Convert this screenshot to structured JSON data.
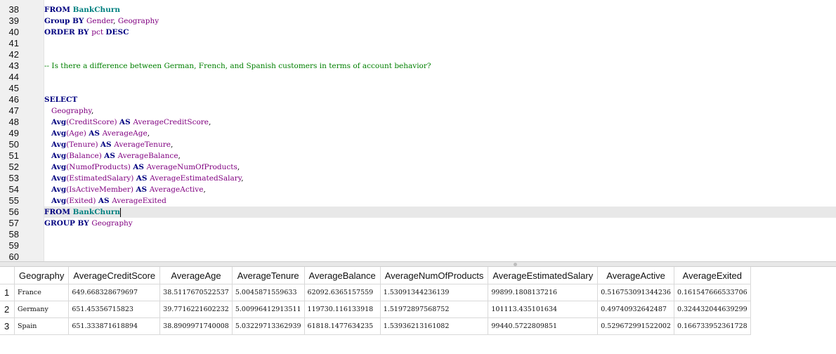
{
  "editor": {
    "line_numbers": [
      "38",
      "39",
      "40",
      "41",
      "42",
      "43",
      "44",
      "45",
      "46",
      "47",
      "48",
      "49",
      "50",
      "51",
      "52",
      "53",
      "54",
      "55",
      "56",
      "57",
      "58",
      "59",
      "60"
    ],
    "current_line": "56",
    "lines": [
      [
        {
          "t": "FROM ",
          "c": "kw"
        },
        {
          "t": "BankChurn",
          "c": "tb"
        }
      ],
      [
        {
          "t": "Group BY ",
          "c": "kw"
        },
        {
          "t": "Gender",
          "c": "id"
        },
        {
          "t": ", ",
          "c": "pl"
        },
        {
          "t": "Geography",
          "c": "id"
        }
      ],
      [
        {
          "t": "ORDER BY ",
          "c": "kw"
        },
        {
          "t": "pct ",
          "c": "id"
        },
        {
          "t": "DESC",
          "c": "kw"
        }
      ],
      [],
      [],
      [
        {
          "t": "-- Is there a difference between German, French, and Spanish customers in terms of account behavior?",
          "c": "cm"
        }
      ],
      [],
      [],
      [
        {
          "t": "SELECT",
          "c": "kw"
        }
      ],
      [
        {
          "t": "   ",
          "c": "pl"
        },
        {
          "t": "Geography",
          "c": "id"
        },
        {
          "t": ",",
          "c": "pl"
        }
      ],
      [
        {
          "t": "   ",
          "c": "pl"
        },
        {
          "t": "Avg",
          "c": "kw"
        },
        {
          "t": "(CreditScore) ",
          "c": "id"
        },
        {
          "t": "AS ",
          "c": "kw"
        },
        {
          "t": "AverageCreditScore",
          "c": "id"
        },
        {
          "t": ",",
          "c": "pl"
        }
      ],
      [
        {
          "t": "   ",
          "c": "pl"
        },
        {
          "t": "Avg",
          "c": "kw"
        },
        {
          "t": "(Age) ",
          "c": "id"
        },
        {
          "t": "AS ",
          "c": "kw"
        },
        {
          "t": "AverageAge",
          "c": "id"
        },
        {
          "t": ",",
          "c": "pl"
        }
      ],
      [
        {
          "t": "   ",
          "c": "pl"
        },
        {
          "t": "Avg",
          "c": "kw"
        },
        {
          "t": "(Tenure) ",
          "c": "id"
        },
        {
          "t": "AS ",
          "c": "kw"
        },
        {
          "t": "AverageTenure",
          "c": "id"
        },
        {
          "t": ",",
          "c": "pl"
        }
      ],
      [
        {
          "t": "   ",
          "c": "pl"
        },
        {
          "t": "Avg",
          "c": "kw"
        },
        {
          "t": "(Balance) ",
          "c": "id"
        },
        {
          "t": "AS ",
          "c": "kw"
        },
        {
          "t": "AverageBalance",
          "c": "id"
        },
        {
          "t": ",",
          "c": "pl"
        }
      ],
      [
        {
          "t": "   ",
          "c": "pl"
        },
        {
          "t": "Avg",
          "c": "kw"
        },
        {
          "t": "(NumofProducts) ",
          "c": "id"
        },
        {
          "t": "AS ",
          "c": "kw"
        },
        {
          "t": "AverageNumOfProducts",
          "c": "id"
        },
        {
          "t": ",",
          "c": "pl"
        }
      ],
      [
        {
          "t": "   ",
          "c": "pl"
        },
        {
          "t": "Avg",
          "c": "kw"
        },
        {
          "t": "(EstimatedSalary) ",
          "c": "id"
        },
        {
          "t": "AS ",
          "c": "kw"
        },
        {
          "t": "AverageEstimatedSalary",
          "c": "id"
        },
        {
          "t": ",",
          "c": "pl"
        }
      ],
      [
        {
          "t": "   ",
          "c": "pl"
        },
        {
          "t": "Avg",
          "c": "kw"
        },
        {
          "t": "(IsActiveMember) ",
          "c": "id"
        },
        {
          "t": "AS ",
          "c": "kw"
        },
        {
          "t": "AverageActive",
          "c": "id"
        },
        {
          "t": ",",
          "c": "pl"
        }
      ],
      [
        {
          "t": "   ",
          "c": "pl"
        },
        {
          "t": "Avg",
          "c": "kw"
        },
        {
          "t": "(Exited) ",
          "c": "id"
        },
        {
          "t": "AS ",
          "c": "kw"
        },
        {
          "t": "AverageExited",
          "c": "id"
        }
      ],
      [
        {
          "t": "FROM ",
          "c": "kw"
        },
        {
          "t": "BankChurn",
          "c": "tb"
        }
      ],
      [
        {
          "t": "GROUP BY ",
          "c": "kw"
        },
        {
          "t": "Geography",
          "c": "id"
        }
      ],
      [],
      [],
      []
    ]
  },
  "results": {
    "columns": [
      "Geography",
      "AverageCreditScore",
      "AverageAge",
      "AverageTenure",
      "AverageBalance",
      "AverageNumOfProducts",
      "AverageEstimatedSalary",
      "AverageActive",
      "AverageExited"
    ],
    "rows": [
      {
        "num": "1",
        "cells": [
          "France",
          "649.668328679697",
          "38.5117670522537",
          "5.0045871559633",
          "62092.6365157559",
          "1.53091344236139",
          "99899.1808137216",
          "0.516753091344236",
          "0.161547666533706"
        ]
      },
      {
        "num": "2",
        "cells": [
          "Germany",
          "651.45356715823",
          "39.7716221602232",
          "5.00996412913511",
          "119730.116133918",
          "1.51972897568752",
          "101113.435101634",
          "0.49740932642487",
          "0.324432044639299"
        ]
      },
      {
        "num": "3",
        "cells": [
          "Spain",
          "651.333871618894",
          "38.8909971740008",
          "5.03229713362939",
          "61818.1477634235",
          "1.53936213161082",
          "99440.5722809851",
          "0.529672991522002",
          "0.166733952361728"
        ]
      }
    ]
  }
}
